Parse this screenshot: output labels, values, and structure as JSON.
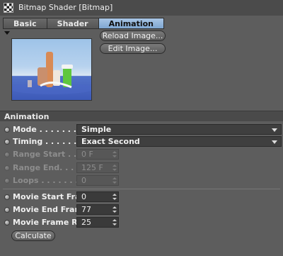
{
  "window": {
    "title": "Bitmap Shader [Bitmap]"
  },
  "tabs": [
    {
      "label": "Basic",
      "active": false
    },
    {
      "label": "Shader",
      "active": false
    },
    {
      "label": "Animation",
      "active": true
    }
  ],
  "preview": {
    "reload_label": "Reload Image...",
    "edit_label": "Edit Image...",
    "thumbnail_alt": "image-thumbnail"
  },
  "section": {
    "title": "Animation"
  },
  "fields": {
    "mode": {
      "label": "Mode . . . . . . . . . . .",
      "value": "Simple",
      "enabled": true
    },
    "timing": {
      "label": "Timing . . . . . . . . . .",
      "value": "Exact Second",
      "enabled": true
    },
    "range_start": {
      "label": "Range Start . . . . . .",
      "value": "0 F",
      "enabled": false
    },
    "range_end": {
      "label": "Range End. . . . . . .",
      "value": "125 F",
      "enabled": false
    },
    "loops": {
      "label": "Loops . . . . . . . . . . .",
      "value": "0",
      "enabled": false
    },
    "movie_start": {
      "label": "Movie Start Frame",
      "value": "0",
      "enabled": true
    },
    "movie_end": {
      "label": "Movie End Frame",
      "value": "77",
      "enabled": true
    },
    "movie_rate": {
      "label": "Movie Frame Rate",
      "value": "25",
      "enabled": true
    }
  },
  "actions": {
    "calculate_label": "Calculate"
  },
  "colors": {
    "background": "#5d5d5d",
    "active_tab": "#8fb3dc",
    "field_bg": "#3f3f3f"
  }
}
